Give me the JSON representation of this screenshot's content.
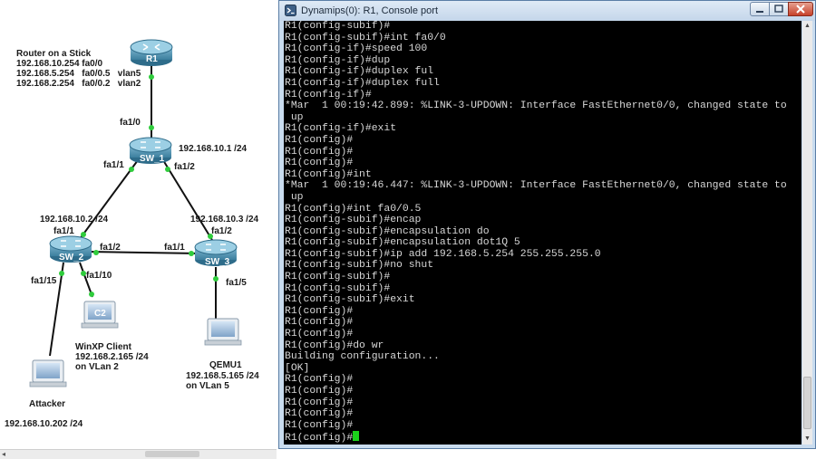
{
  "topology": {
    "r1_label": "R1",
    "router_note_title": "Router on a Stick",
    "router_note_lines": [
      "192.168.10.254 fa0/0",
      "192.168.5.254   fa0/0.5   vlan5",
      "192.168.2.254   fa0/0.2   vlan2"
    ],
    "r1_port": "fa1/0",
    "sw1_label": "SW_1",
    "sw1_ip": "192.168.10.1 /24",
    "sw1_port_left": "fa1/1",
    "sw1_port_right": "fa1/2",
    "sw2_label": "SW_2",
    "sw2_ip": "192.168.10.2 /24",
    "sw2_port_up": "fa1/1",
    "sw2_port_right": "fa1/2",
    "sw2_port_c2": "fa1/10",
    "sw2_port_attacker": "fa1/15",
    "sw3_label": "SW_3",
    "sw3_ip": "192.168.10.3 /24",
    "sw3_port_up": "fa1/2",
    "sw3_port_left": "fa1/1",
    "sw3_port_qemu": "fa1/5",
    "c2_label": "C2",
    "c2_lines": [
      "WinXP Client",
      "192.168.2.165 /24",
      "on VLan 2"
    ],
    "qemu_lines": [
      "QEMU1",
      "192.168.5.165 /24",
      "on VLan 5"
    ],
    "attacker_label": "Attacker",
    "attacker_ip": "192.168.10.202 /24",
    "link_dot_color": "#2fcc3c",
    "link_color": "#111111"
  },
  "console": {
    "title": "Dynamips(0): R1, Console port",
    "prompt_cursor_color": "#1bd11b",
    "lines": [
      "R1(config-subif)#",
      "R1(config-subif)#int fa0/0",
      "R1(config-if)#speed 100",
      "R1(config-if)#dup",
      "R1(config-if)#duplex ful",
      "R1(config-if)#duplex full",
      "R1(config-if)#",
      "*Mar  1 00:19:42.899: %LINK-3-UPDOWN: Interface FastEthernet0/0, changed state to",
      " up",
      "R1(config-if)#exit",
      "R1(config)#",
      "R1(config)#",
      "R1(config)#",
      "R1(config)#int",
      "*Mar  1 00:19:46.447: %LINK-3-UPDOWN: Interface FastEthernet0/0, changed state to",
      " up",
      "R1(config)#int fa0/0.5",
      "R1(config-subif)#encap",
      "R1(config-subif)#encapsulation do",
      "R1(config-subif)#encapsulation dot1Q 5",
      "R1(config-subif)#ip add 192.168.5.254 255.255.255.0",
      "R1(config-subif)#no shut",
      "R1(config-subif)#",
      "R1(config-subif)#",
      "R1(config-subif)#exit",
      "R1(config)#",
      "R1(config)#",
      "R1(config)#",
      "R1(config)#do wr",
      "Building configuration...",
      "[OK]",
      "R1(config)#",
      "R1(config)#",
      "R1(config)#",
      "R1(config)#",
      "R1(config)#",
      "R1(config)#"
    ]
  }
}
